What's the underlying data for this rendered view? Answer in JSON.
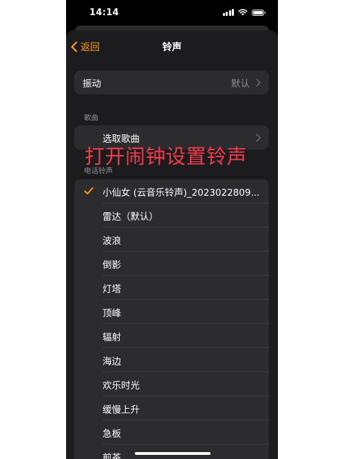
{
  "status_bar": {
    "time": "14:14",
    "signal_icon": "signal-bars-icon",
    "wifi_icon": "wifi-icon",
    "battery_icon": "battery-full-icon"
  },
  "nav": {
    "back_label": "返回",
    "back_icon": "chevron-left-icon",
    "title": "铃声"
  },
  "vibration": {
    "label": "振动",
    "value": "默认"
  },
  "songs": {
    "header": "歌曲",
    "pick_label": "选取歌曲"
  },
  "overlay_caption": "打开闹钟设置铃声",
  "ringtones": {
    "header": "电话铃声",
    "selected_index": 0,
    "items": [
      {
        "label": "小仙女 (云音乐铃声)_2023022809..."
      },
      {
        "label": "雷达（默认）"
      },
      {
        "label": "波浪"
      },
      {
        "label": "倒影"
      },
      {
        "label": "灯塔"
      },
      {
        "label": "顶峰"
      },
      {
        "label": "辐射"
      },
      {
        "label": "海边"
      },
      {
        "label": "欢乐时光"
      },
      {
        "label": "缓慢上升"
      },
      {
        "label": "急板"
      },
      {
        "label": "煎茶"
      }
    ]
  },
  "colors": {
    "accent": "#ff9f0a",
    "sheet_background": "#1c1c1f",
    "cell_background": "#2c2c2f",
    "secondary_text": "#8e8e93",
    "caption": "#f03c4a"
  }
}
